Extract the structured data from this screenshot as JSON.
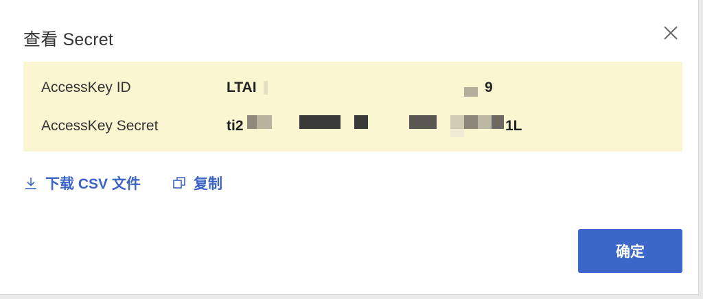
{
  "dialog": {
    "title": "查看 Secret",
    "close_icon": "close-icon"
  },
  "credentials": {
    "access_key_id": {
      "label": "AccessKey ID",
      "value_start": "LTAI",
      "value_end": "9"
    },
    "access_key_secret": {
      "label": "AccessKey Secret",
      "value_start": "ti2",
      "value_end": "1L"
    }
  },
  "actions": {
    "download_label": "下载 CSV 文件",
    "download_icon": "download-icon",
    "copy_label": "复制",
    "copy_icon": "copy-icon"
  },
  "footer": {
    "confirm_label": "确定"
  },
  "colors": {
    "accent": "#3c66c8",
    "link": "#3a63c6",
    "highlight_bg": "#fbf6d2"
  }
}
